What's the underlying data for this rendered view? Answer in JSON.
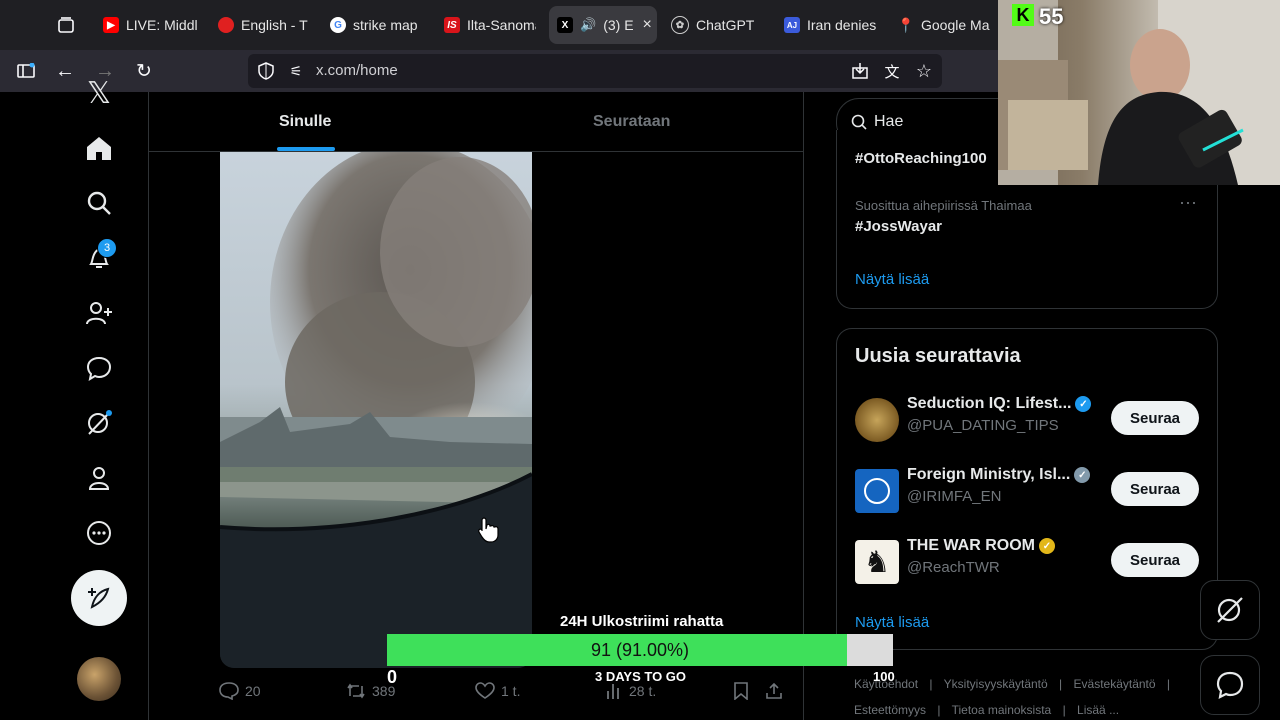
{
  "browser": {
    "tabs": [
      {
        "label": "LIVE: Middl",
        "icon": "youtube-icon"
      },
      {
        "label": "English - Tz",
        "icon": "red-globe-icon"
      },
      {
        "label": "strike map",
        "icon": "google-icon"
      },
      {
        "label": "Ilta-Sanoma",
        "icon": "is-icon"
      },
      {
        "label": "(3) E",
        "icon": "x-icon",
        "active": true
      },
      {
        "label": "ChatGPT",
        "icon": "openai-icon"
      },
      {
        "label": "Iran denies",
        "icon": "aj-icon"
      },
      {
        "label": "Google Ma",
        "icon": "maps-icon"
      }
    ],
    "url": "x.com/home"
  },
  "nav": {
    "notification_count": "3"
  },
  "feed": {
    "tabs": {
      "for_you": "Sinulle",
      "following": "Seurataan"
    },
    "post": {
      "replies": "20",
      "reposts": "389",
      "likes": "1 t.",
      "views": "28 t."
    }
  },
  "sidebar": {
    "search_placeholder": "Hae",
    "trends": [
      {
        "context": "",
        "name": "#OttoReaching100"
      },
      {
        "context": "Suosittua aihepiirissä Thaimaa",
        "name": "#JossWayar"
      }
    ],
    "trends_more": "Näytä lisää",
    "who_to_follow": {
      "title": "Uusia seurattavia",
      "accounts": [
        {
          "name": "Seduction IQ: Lifest...",
          "handle": "@PUA_DATING_TIPS",
          "badge": "#1d9bf0"
        },
        {
          "name": "Foreign Ministry, Isl...",
          "handle": "@IRIMFA_EN",
          "badge": "#829aab"
        },
        {
          "name": "THE WAR ROOM",
          "handle": "@ReachTWR",
          "badge": "#e2b719"
        }
      ],
      "follow_label": "Seuraa",
      "more": "Näytä lisää"
    },
    "footer_links": [
      "Käyttöehdot",
      "|",
      "Yksityisyyskäytäntö",
      "|",
      "Evästekäytäntö",
      "|",
      "Esteettömyys",
      "|",
      "Tietoa mainoksista",
      "|",
      "Lisää ..."
    ]
  },
  "stream": {
    "viewer_count": "55",
    "goal_title": "24H Ulkostriimi rahatta",
    "goal_value_text": "91 (91.00%)",
    "goal_progress": 0.91,
    "goal_min": "0",
    "goal_max": "100",
    "goal_days": "3 DAYS TO GO"
  },
  "colors": {
    "accent": "#1d9bf0",
    "goal_fill": "#3ee05a",
    "kick_green": "#53fc18"
  }
}
